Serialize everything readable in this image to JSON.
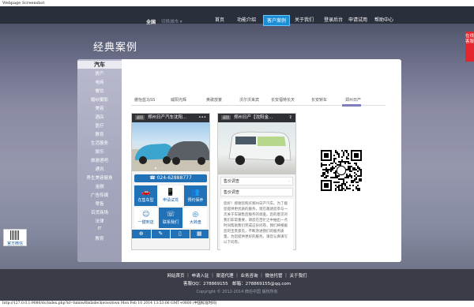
{
  "browser": {
    "window_title": "Webpage Screenshot",
    "status_url": "http://127.0.0.1:9080/dc/index.php?id=hmnwRmIzdeckwiosrnwn Mon Feb 10 2014 13:53:06 GMT+0800 (中国标准时间)"
  },
  "header": {
    "city": "全国",
    "city_switch": "切换城市",
    "nav": [
      "首页",
      "功能介绍",
      "客户案例",
      "关于我们",
      "登录后台",
      "申请试用",
      "帮助中心"
    ],
    "active_nav_index": 2
  },
  "page": {
    "title": "经典案例"
  },
  "side_tab": {
    "label": "在线客服"
  },
  "sidebar": {
    "items": [
      "汽车",
      "房产",
      "电商",
      "餐饮",
      "婚纱摄影",
      "美容",
      "酒店",
      "医疗",
      "教育",
      "生活服务",
      "娱乐",
      "旅游酒吧",
      "通讯",
      "养生美容健身",
      "金融",
      "广告传媒",
      "零售",
      "百货商场",
      "法律",
      "IT",
      "教育"
    ],
    "active_index": 0
  },
  "case_tabs": [
    "傲怡蓝马SS",
    "威阳光辉",
    "奥歌放宴",
    "沃尔沃来宾",
    "长安福特长天",
    "长安轿车",
    "郑州日产"
  ],
  "active_case_tab": 6,
  "phone1": {
    "header": "郑州日产汽车沈阳...",
    "back_label": "返回",
    "phone_label": "024-62888777",
    "grid": [
      "在售车型",
      "申请试驾",
      "预约保养",
      "一键到店",
      "联系我们",
      "大转盘"
    ],
    "grid_icons": [
      "🚗",
      "📱",
      "👥",
      "☺",
      "☏",
      "◎"
    ]
  },
  "phone2": {
    "header": "郑州日产【沈阳金...",
    "back_label": "返回",
    "rows": [
      "售价调查",
      "售价调查"
    ],
    "body_text": "您好！感谢您购买郑州日产汽车。为了能您提供更优质的服务，现在邀请您参与一次关于车辆售后服务的调查。您的意见对我们非常重要，请您在百忙之中抽出一点时间帮助我们完成这份问卷，我们将根据您的宝贵意见，不断改进我们的服务质量，为您提供更好的服务。请您认真填写以下问卷。"
  },
  "left_widget": {
    "label": "官方微信"
  },
  "footer": {
    "links": [
      "网站首页",
      "申请入驻",
      "渠道代理",
      "业务咨询",
      "微信托管",
      "关于我们"
    ],
    "contact": "客服QQ：278869155　邮箱：278869155@qq.com",
    "copyright": "Copyright © 2012-2014 微信中国 版权所有"
  }
}
